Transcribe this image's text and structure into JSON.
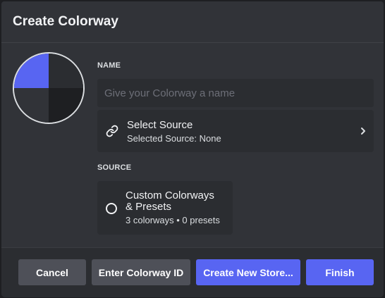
{
  "dialog": {
    "title": "Create Colorway"
  },
  "preview": {
    "colors": [
      "#5865f2",
      "#2b2d31",
      "#313338",
      "#1e1f22"
    ]
  },
  "name_section": {
    "label": "NAME",
    "placeholder": "Give your Colorway a name",
    "value": ""
  },
  "select_source": {
    "title": "Select Source",
    "subtitle": "Selected Source: None",
    "icon": "link-icon",
    "chevron": "chevron-right-icon"
  },
  "source_section": {
    "label": "SOURCE",
    "option": {
      "title": "Custom Colorways & Presets",
      "subtitle": "3 colorways • 0 presets",
      "selected": false
    }
  },
  "footer": {
    "cancel_label": "Cancel",
    "enter_id_label": "Enter Colorway ID",
    "create_store_label": "Create New Store...",
    "finish_label": "Finish"
  },
  "colors": {
    "brand": "#5865f2",
    "background": "#313338",
    "secondary_background": "#2b2d31",
    "tertiary_background": "#1e1f22",
    "secondary_button": "#4e5058",
    "text": "#f2f3f5",
    "muted_text": "#6d6f78"
  }
}
